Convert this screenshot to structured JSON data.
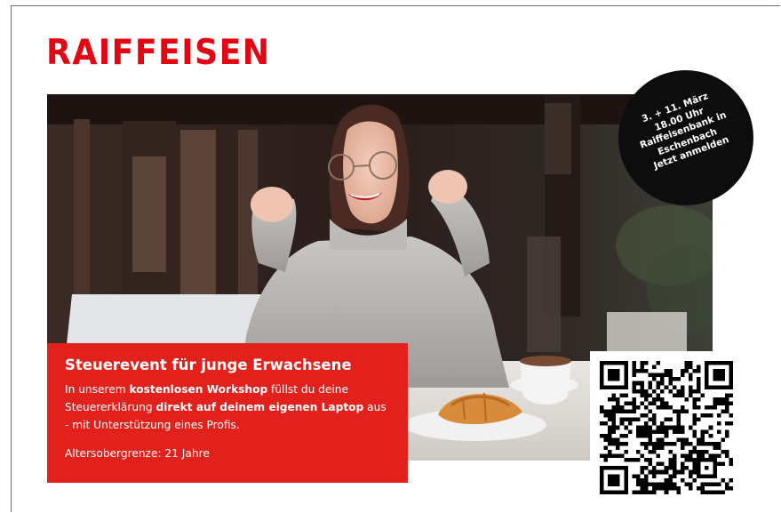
{
  "brand": {
    "logo_text": "RAIFFEISEN",
    "color": "#e30613"
  },
  "event_badge": {
    "lines": [
      "3. + 11. März",
      "18.00 Uhr",
      "Raiffeisenbank in",
      "Eschenbach",
      "Jetzt anmelden"
    ]
  },
  "promo": {
    "title": "Steuerevent für junge Erwachsene",
    "text_1": "In unserem ",
    "text_2": "kostenlosen Workshop",
    "text_3": " füllst du deine Steuererklärung ",
    "text_4": "direkt auf deinem eigenen Laptop",
    "text_5": " aus - mit Unterstützung eines Profis.",
    "age_limit": "Altersobergrenze: 21 Jahre",
    "background": "#e2211c"
  },
  "photo": {
    "subject": "smiling-woman-with-laptop-and-croissant"
  },
  "qr_code": {
    "icon": "qr-code-icon"
  }
}
